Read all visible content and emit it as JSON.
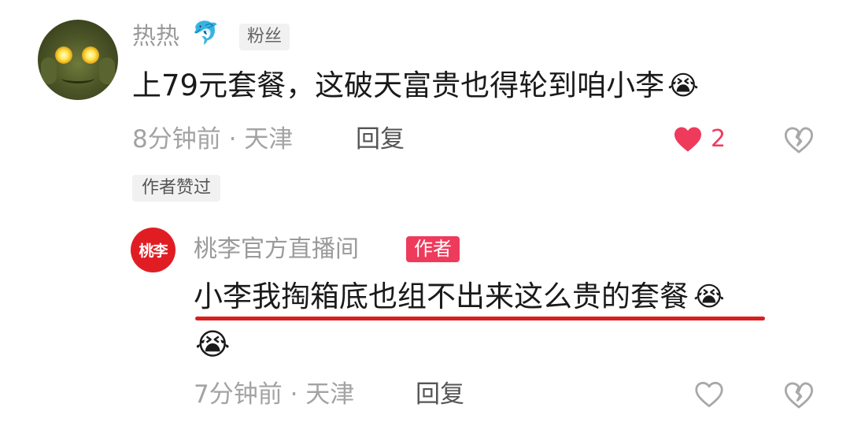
{
  "comment": {
    "username": "热热",
    "username_emoji": "🐬",
    "fan_badge": "粉丝",
    "text": "上79元套餐，这破天富贵也得轮到咱小李",
    "text_emoji": "😭",
    "time_location": "8分钟前 · 天津",
    "reply_label": "回复",
    "like_count": "2",
    "liked_by_author_label": "作者赞过"
  },
  "reply": {
    "avatar_text": "桃李",
    "username": "桃李官方直播间",
    "author_badge": "作者",
    "text": "小李我掏箱底也组不出来这么贵的套餐",
    "text_emoji": "😭",
    "extra_emoji": "😭",
    "time_location": "7分钟前 · 天津",
    "reply_label": "回复"
  },
  "colors": {
    "like_active": "#ee3b5b",
    "meta_text": "#a3a3a3",
    "author_badge_bg": "#ee3b5b",
    "brand_avatar_bg": "#e11d24",
    "annotation_underline": "#d81e1e"
  },
  "icons": {
    "like_filled": "heart-filled-icon",
    "like_outline": "heart-outline-icon",
    "dislike": "broken-heart-icon"
  }
}
